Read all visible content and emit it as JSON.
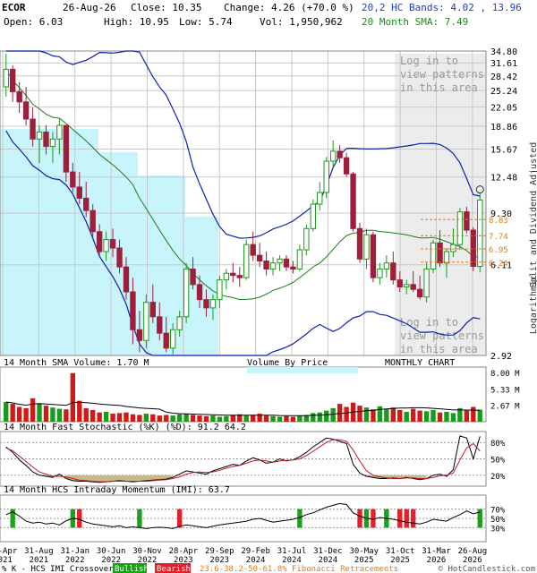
{
  "header": {
    "ticker": "ECOR",
    "date": "26-Aug-26",
    "close_label": "Close: 10.35",
    "change_label": "Change: 4.26 (+70.0 %)",
    "open_label": "Open: 6.03",
    "high_label": "High: 10.95",
    "low_label": "Low: 5.74",
    "vol_label": "Vol: 1,950,962",
    "bands_label": "20,2 HC Bands: 4.02 , 13.96",
    "sma_label": "20 Month SMA: 7.49"
  },
  "login_notice": "Log in to view patterns in this area",
  "side_label": "Split and Dividend Adjusted",
  "log_label": "Logarithmic",
  "panels": {
    "volume_title": "14 Month SMA Volume: 1.70 M",
    "vbp_label": "Volume By Price",
    "monthly_label": "MONTHLY CHART",
    "stoch_title": "14 Month Fast Stochastic (%K) (%D): 91.2  64.2",
    "imi_title": "14 Month HCS Intraday Momentum (IMI): 63.7"
  },
  "footer": {
    "crossover_text": "% K - HCS IMI Crossover:",
    "bullish": "Bullish",
    "bearish": "Bearish",
    "fib_text": "23.6-38.2-50-61.8% Fibonacci Retracements",
    "copyright": "© HotCandlestick.com"
  },
  "colors": {
    "up": "#1a9a1a",
    "down": "#9e1f3c",
    "band": "#0b1fb0",
    "sma": "#148014",
    "shade": "#c8f4fb",
    "fib": "#e07a16",
    "grid": "#c8c8c8"
  },
  "chart_data": [
    {
      "type": "candlestick",
      "title": "ECOR",
      "scale": "log",
      "ylim": [
        2.92,
        34.8
      ],
      "y_ticks": [
        34.8,
        31.61,
        28.42,
        25.24,
        22.05,
        18.86,
        15.67,
        12.48,
        9.3,
        6.11,
        2.92
      ],
      "x_ticks": [
        "30-Apr\n2021",
        "31-Aug\n2021",
        "31-Jan\n2022",
        "30-Jun\n2022",
        "30-Nov\n2022",
        "28-Apr\n2023",
        "29-Sep\n2023",
        "29-Feb\n2024",
        "31-Jul\n2024",
        "31-Dec\n2024",
        "30-May\n2025",
        "31-Oct\n2025",
        "31-Mar\n2026",
        "26-Aug\n2026"
      ],
      "fib_levels": [
        8.83,
        7.74,
        6.95,
        6.24
      ],
      "ohlc": [
        [
          26,
          34,
          24,
          30
        ],
        [
          30,
          31,
          23,
          25
        ],
        [
          25,
          27,
          21,
          23
        ],
        [
          23,
          26,
          19,
          20
        ],
        [
          20,
          22,
          16,
          17
        ],
        [
          17,
          19,
          14,
          18
        ],
        [
          18,
          19,
          15,
          16
        ],
        [
          16,
          18,
          14,
          17
        ],
        [
          17,
          20,
          15,
          19
        ],
        [
          19,
          19,
          12,
          13
        ],
        [
          13,
          14,
          11,
          11.5
        ],
        [
          11.5,
          13,
          10,
          10.5
        ],
        [
          10.5,
          12,
          9,
          9.5
        ],
        [
          9.5,
          10,
          7.5,
          8
        ],
        [
          8,
          8.5,
          6.5,
          6.8
        ],
        [
          6.8,
          8,
          6.3,
          7.5
        ],
        [
          7.5,
          8.2,
          6.5,
          7
        ],
        [
          7,
          7.5,
          5.7,
          6
        ],
        [
          6,
          6.5,
          4.6,
          4.9
        ],
        [
          4.9,
          5.5,
          3.2,
          3.6
        ],
        [
          3.6,
          4.2,
          3,
          3.3
        ],
        [
          3.3,
          4.8,
          3.1,
          4.5
        ],
        [
          4.5,
          5.2,
          3.8,
          4
        ],
        [
          4,
          4.5,
          3.3,
          3.5
        ],
        [
          3.5,
          4,
          3,
          3.1
        ],
        [
          3.1,
          3.8,
          2.95,
          3.6
        ],
        [
          3.6,
          4.2,
          3.4,
          4
        ],
        [
          4,
          6.2,
          3.8,
          5.9
        ],
        [
          5.9,
          6.5,
          5,
          5.2
        ],
        [
          5.2,
          5.6,
          4.3,
          4.6
        ],
        [
          4.6,
          5,
          4,
          4.3
        ],
        [
          4.3,
          4.8,
          3.9,
          4.6
        ],
        [
          4.6,
          5.6,
          4.3,
          5.4
        ],
        [
          5.4,
          5.9,
          5,
          5.7
        ],
        [
          5.7,
          6.2,
          5.3,
          5.6
        ],
        [
          5.6,
          6,
          5.1,
          5.5
        ],
        [
          5.5,
          7.5,
          5.4,
          7.2
        ],
        [
          7.2,
          8,
          6.3,
          6.6
        ],
        [
          6.6,
          7.3,
          6,
          6.3
        ],
        [
          6.3,
          6.8,
          5.6,
          5.9
        ],
        [
          5.9,
          6.5,
          5.6,
          6.2
        ],
        [
          6.2,
          6.6,
          5.8,
          6.4
        ],
        [
          6.4,
          6.6,
          5.8,
          6
        ],
        [
          6,
          6.3,
          5.7,
          5.9
        ],
        [
          5.9,
          7.2,
          5.8,
          6.9
        ],
        [
          6.9,
          8.5,
          6.6,
          8.2
        ],
        [
          8.2,
          10.4,
          8,
          10
        ],
        [
          10,
          12,
          9.5,
          11
        ],
        [
          11,
          14.7,
          10.5,
          14.2
        ],
        [
          14.2,
          16.8,
          13.5,
          15.4
        ],
        [
          15.4,
          16.2,
          14,
          14.6
        ],
        [
          14.6,
          15.2,
          12.5,
          12.8
        ],
        [
          12.8,
          13,
          8,
          8.2
        ],
        [
          8.2,
          8.6,
          6.2,
          6.4
        ],
        [
          6.4,
          8.2,
          5.9,
          7.8
        ],
        [
          7.8,
          8,
          5.3,
          5.5
        ],
        [
          5.5,
          6.2,
          5.2,
          5.9
        ],
        [
          5.9,
          6.6,
          5.5,
          6.2
        ],
        [
          6.2,
          6.8,
          5.2,
          5.4
        ],
        [
          5.4,
          5.8,
          4.9,
          5.1
        ],
        [
          5.1,
          5.4,
          4.8,
          5.2
        ],
        [
          5.2,
          5.8,
          4.9,
          5
        ],
        [
          5,
          5.6,
          4.6,
          4.7
        ],
        [
          4.7,
          6.2,
          4.5,
          5.9
        ],
        [
          5.9,
          7.5,
          5.7,
          7.3
        ],
        [
          7.3,
          8.1,
          6,
          6.2
        ],
        [
          6.2,
          7,
          5.5,
          6.8
        ],
        [
          6.8,
          8.2,
          6.5,
          7.2
        ],
        [
          7.2,
          9.7,
          6.9,
          9.4
        ],
        [
          9.4,
          9.8,
          7.9,
          8.1
        ],
        [
          8.1,
          8.3,
          5.8,
          6.03
        ],
        [
          6.03,
          10.95,
          5.74,
          10.35
        ]
      ],
      "fib_line_series": {
        "name": "",
        "note": ""
      }
    },
    {
      "type": "bar",
      "title": "14 Month SMA Volume: 1.70 M",
      "ylim": [
        0,
        8.0
      ],
      "y_ticks": [
        8.0,
        5.33,
        2.67
      ],
      "unit": "M",
      "volume_m": [
        3.2,
        2.9,
        2.4,
        2.2,
        3.8,
        3.0,
        2.6,
        2.3,
        2.1,
        2.0,
        7.9,
        3.4,
        2.2,
        1.9,
        1.5,
        1.6,
        1.3,
        1.4,
        1.5,
        1.2,
        1.1,
        1.3,
        1.2,
        1.0,
        1.1,
        1.0,
        1.2,
        1.3,
        1.1,
        1.0,
        0.9,
        1.0,
        0.8,
        0.9,
        1.1,
        1.2,
        1.0,
        1.1,
        1.3,
        1.0,
        0.9,
        0.8,
        0.9,
        0.8,
        1.0,
        1.1,
        1.4,
        1.5,
        1.8,
        2.2,
        2.9,
        2.4,
        3.1,
        2.6,
        2.3,
        2.0,
        2.5,
        2.1,
        2.3,
        1.9,
        1.6,
        2.1,
        1.8,
        1.7,
        1.9,
        1.5,
        1.6,
        1.4,
        2.2,
        1.8,
        2.4,
        1.95
      ]
    },
    {
      "type": "line",
      "title": "14 Month Fast Stochastic (%K) (%D): 91.2  64.2",
      "ylim": [
        0,
        100
      ],
      "y_ticks": [
        80,
        50,
        20
      ],
      "series": [
        {
          "name": "%K",
          "values": [
            72,
            62,
            48,
            38,
            26,
            20,
            18,
            16,
            22,
            14,
            10,
            9,
            9,
            8,
            7,
            8,
            9,
            10,
            9,
            8,
            9,
            10,
            11,
            12,
            13,
            16,
            22,
            28,
            26,
            24,
            22,
            28,
            32,
            36,
            40,
            38,
            46,
            52,
            48,
            42,
            44,
            50,
            46,
            48,
            54,
            62,
            72,
            80,
            88,
            86,
            82,
            78,
            40,
            24,
            18,
            16,
            14,
            14,
            15,
            14,
            16,
            14,
            12,
            14,
            20,
            22,
            18,
            30,
            92,
            88,
            50,
            91.2
          ]
        },
        {
          "name": "%D",
          "values": [
            70,
            65,
            55,
            45,
            35,
            26,
            22,
            18,
            18,
            17,
            14,
            11,
            10,
            9,
            8,
            8,
            9,
            9,
            9,
            9,
            9,
            9,
            10,
            11,
            12,
            14,
            17,
            22,
            25,
            26,
            25,
            26,
            29,
            33,
            36,
            38,
            42,
            46,
            48,
            46,
            44,
            46,
            47,
            48,
            50,
            56,
            64,
            72,
            80,
            85,
            85,
            82,
            66,
            46,
            28,
            20,
            17,
            15,
            14,
            14,
            15,
            15,
            14,
            14,
            16,
            19,
            20,
            24,
            48,
            70,
            78,
            64.2
          ]
        }
      ]
    },
    {
      "type": "line",
      "title": "14 Month HCS Intraday Momentum (IMI): 63.7",
      "ylim": [
        0,
        100
      ],
      "y_ticks": [
        70,
        50,
        30
      ],
      "series": [
        {
          "name": "IMI",
          "values": [
            58,
            64,
            55,
            44,
            40,
            42,
            38,
            40,
            36,
            45,
            50,
            48,
            42,
            38,
            36,
            34,
            32,
            34,
            30,
            32,
            30,
            28,
            30,
            31,
            30,
            28,
            33,
            36,
            34,
            32,
            30,
            33,
            36,
            38,
            40,
            42,
            44,
            48,
            50,
            46,
            42,
            44,
            46,
            48,
            52,
            58,
            62,
            68,
            74,
            78,
            82,
            80,
            62,
            55,
            50,
            48,
            52,
            50,
            48,
            45,
            42,
            40,
            38,
            42,
            48,
            46,
            44,
            52,
            58,
            66,
            60,
            63.7
          ]
        }
      ],
      "signals": [
        {
          "index": 1,
          "kind": "bullish"
        },
        {
          "index": 10,
          "kind": "bullish"
        },
        {
          "index": 11,
          "kind": "bearish"
        },
        {
          "index": 20,
          "kind": "bullish"
        },
        {
          "index": 26,
          "kind": "bearish"
        },
        {
          "index": 44,
          "kind": "bullish"
        },
        {
          "index": 53,
          "kind": "bearish"
        },
        {
          "index": 54,
          "kind": "bullish"
        },
        {
          "index": 55,
          "kind": "bearish"
        },
        {
          "index": 57,
          "kind": "bullish"
        },
        {
          "index": 59,
          "kind": "bearish"
        },
        {
          "index": 60,
          "kind": "bearish"
        },
        {
          "index": 61,
          "kind": "bearish"
        },
        {
          "index": 71,
          "kind": "bullish"
        },
        {
          "index": 72,
          "kind": "bearish"
        },
        {
          "index": 73,
          "kind": "bullish"
        }
      ]
    }
  ]
}
